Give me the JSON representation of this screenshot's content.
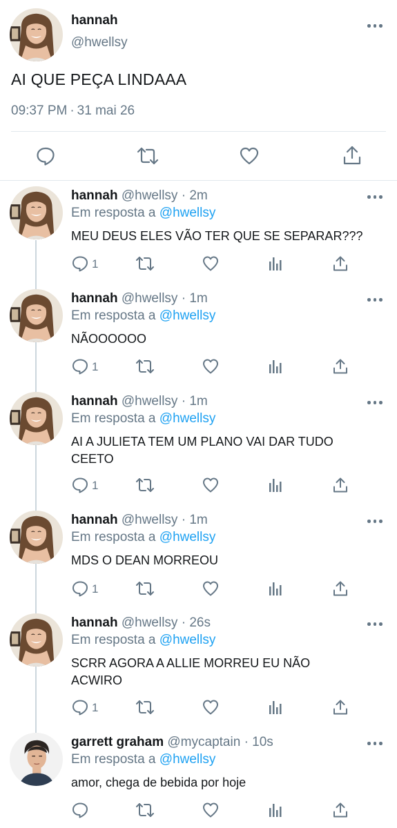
{
  "main_tweet": {
    "name": "hannah",
    "handle": "@hwellsy",
    "text": "AI QUE PEÇA LINDAAA",
    "time": "09:37 PM",
    "separator": "·",
    "date": "31 mai 26"
  },
  "replying_prefix": "Em resposta a",
  "dot": "·",
  "replies": [
    {
      "name": "hannah",
      "handle": "@hwellsy",
      "time": "2m",
      "reply_to": "@hwellsy",
      "text": "MEU DEUS ELES VÃO TER QUE SE SEPARAR???",
      "reply_count": "1",
      "avatar": "hannah"
    },
    {
      "name": "hannah",
      "handle": "@hwellsy",
      "time": "1m",
      "reply_to": "@hwellsy",
      "text": "NÃOOOOOO",
      "reply_count": "1",
      "avatar": "hannah"
    },
    {
      "name": "hannah",
      "handle": "@hwellsy",
      "time": "1m",
      "reply_to": "@hwellsy",
      "text": "AI A JULIETA TEM UM PLANO VAI DAR TUDO CEETO",
      "reply_count": "1",
      "avatar": "hannah"
    },
    {
      "name": "hannah",
      "handle": "@hwellsy",
      "time": "1m",
      "reply_to": "@hwellsy",
      "text": "MDS O DEAN MORREOU",
      "reply_count": "1",
      "avatar": "hannah"
    },
    {
      "name": "hannah",
      "handle": "@hwellsy",
      "time": "26s",
      "reply_to": "@hwellsy",
      "text": "SCRR AGORA A ALLIE MORREU EU NÃO ACWIRO",
      "reply_count": "1",
      "avatar": "hannah"
    },
    {
      "name": "garrett graham",
      "handle": "@mycaptain",
      "time": "10s",
      "reply_to": "@hwellsy",
      "text": "amor, chega de bebida por hoje",
      "reply_count": "",
      "avatar": "garrett"
    }
  ],
  "icons": {
    "reply": "speech-bubble-icon",
    "retweet": "retweet-arrows-icon",
    "like": "heart-icon",
    "analytics": "bar-chart-icon",
    "share": "share-upload-icon",
    "more": "more-dots-icon"
  },
  "colors": {
    "text": "#14171a",
    "secondary": "#657786",
    "link": "#1da1f2",
    "divider": "#e1e8ed",
    "thread_line": "#ccd6dd"
  }
}
